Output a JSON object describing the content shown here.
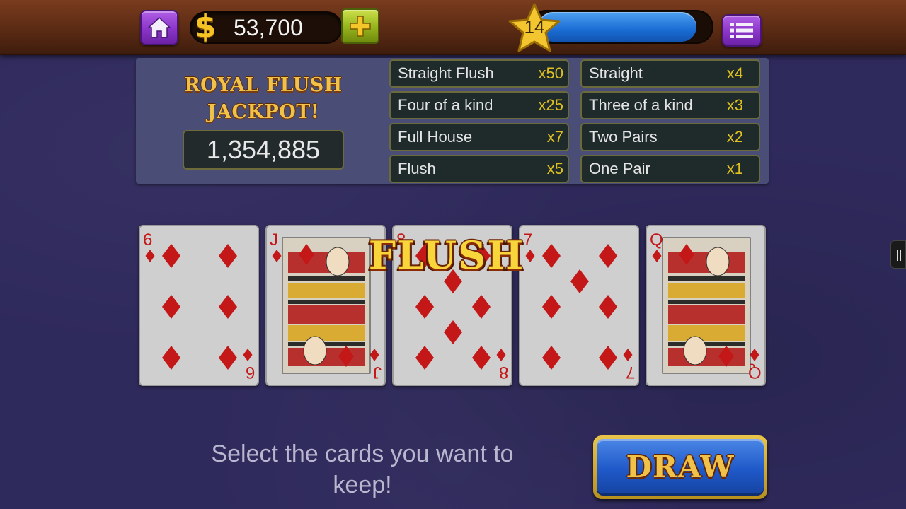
{
  "topbar": {
    "coins": "53,700",
    "currency_symbol": "$",
    "level": "14",
    "xp_progress": 0.95,
    "icons": {
      "home": "home-icon",
      "add": "plus-icon",
      "level": "star-icon",
      "menu": "list-menu-icon"
    }
  },
  "jackpot": {
    "title_line1": "ROYAL FLUSH",
    "title_line2": "JACKPOT!",
    "amount": "1,354,885"
  },
  "paytable": {
    "left": [
      {
        "name": "Straight Flush",
        "mult": "x50"
      },
      {
        "name": "Four of a kind",
        "mult": "x25"
      },
      {
        "name": "Full House",
        "mult": "x7"
      },
      {
        "name": "Flush",
        "mult": "x5"
      }
    ],
    "right": [
      {
        "name": "Straight",
        "mult": "x4"
      },
      {
        "name": "Three of a kind",
        "mult": "x3"
      },
      {
        "name": "Two Pairs",
        "mult": "x2"
      },
      {
        "name": "One Pair",
        "mult": "x1"
      }
    ]
  },
  "cards": [
    {
      "rank": "6",
      "suit": "diamonds"
    },
    {
      "rank": "J",
      "suit": "diamonds"
    },
    {
      "rank": "8",
      "suit": "diamonds"
    },
    {
      "rank": "7",
      "suit": "diamonds"
    },
    {
      "rank": "Q",
      "suit": "diamonds"
    }
  ],
  "result": "FLUSH",
  "hint": "Select the cards you want to keep!",
  "draw_label": "DRAW",
  "colors": {
    "background": "#2f2a5c",
    "card_red": "#c41818",
    "gold": "#f1c24a",
    "xp_blue": "#1a6cd4"
  }
}
